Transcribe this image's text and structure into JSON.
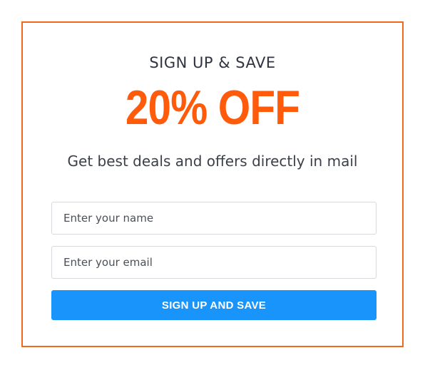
{
  "popup": {
    "eyebrow": "SIGN UP & SAVE",
    "headline": "20% OFF",
    "tagline": "Get best deals and offers directly in mail",
    "name_field": {
      "value": "",
      "placeholder": "Enter your name"
    },
    "email_field": {
      "value": "",
      "placeholder": "Enter your email"
    },
    "submit_label": "SIGN UP AND SAVE"
  },
  "colors": {
    "border": "#ef6a1f",
    "headline": "#ff5b0a",
    "button": "#1994fb",
    "text": "#2f3440"
  }
}
